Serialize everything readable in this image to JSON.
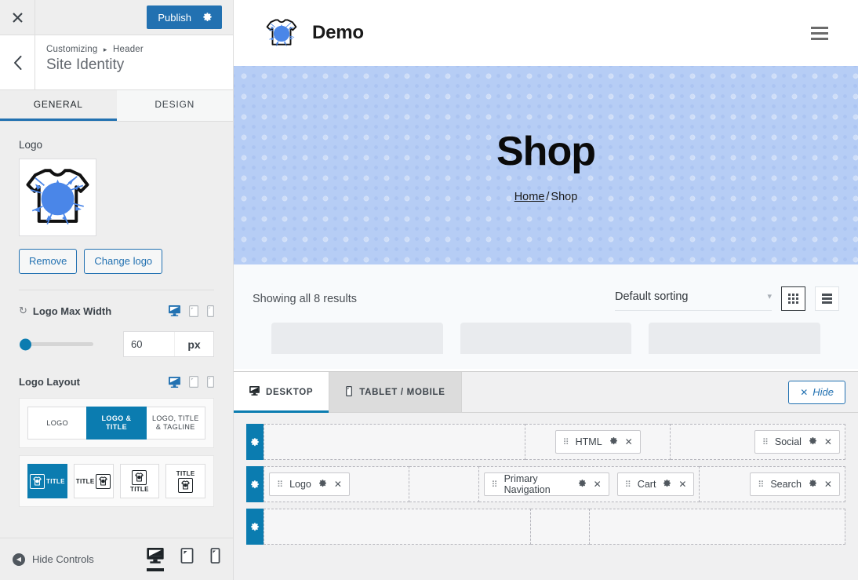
{
  "customizer": {
    "close_icon": "close-icon",
    "publish_label": "Publish",
    "publish_gear_icon": "gear-icon",
    "back_icon": "chevron-left-icon",
    "breadcrumb_root": "Customizing",
    "breadcrumb_sep": "▸",
    "breadcrumb_section": "Header",
    "panel_title": "Site Identity",
    "tabs": [
      {
        "label": "GENERAL",
        "active": true
      },
      {
        "label": "DESIGN",
        "active": false
      }
    ],
    "logo": {
      "label": "Logo",
      "image_alt": "tshirt-splatter-logo",
      "remove_label": "Remove",
      "change_label": "Change logo"
    },
    "logo_max_width": {
      "label": "Logo Max Width",
      "reset_icon": "reset-icon",
      "value": "60",
      "unit": "px",
      "devices": [
        {
          "name": "desktop-icon",
          "active": true
        },
        {
          "name": "tablet-icon",
          "active": false
        },
        {
          "name": "mobile-icon",
          "active": false
        }
      ]
    },
    "logo_layout": {
      "label": "Logo Layout",
      "devices": [
        {
          "name": "desktop-icon",
          "active": true
        },
        {
          "name": "tablet-icon",
          "active": false
        },
        {
          "name": "mobile-icon",
          "active": false
        }
      ],
      "options": [
        {
          "label": "LOGO",
          "active": false
        },
        {
          "label": "LOGO & TITLE",
          "active": true
        },
        {
          "label": "LOGO, TITLE & TAGLINE",
          "active": false
        }
      ],
      "positions": [
        {
          "name": "logo-left-title-right",
          "title": "TITLE",
          "active": true
        },
        {
          "name": "title-left-logo-right",
          "title": "TITLE",
          "active": false
        },
        {
          "name": "logo-top-title-bottom",
          "title": "TITLE",
          "active": false
        },
        {
          "name": "title-top-logo-bottom",
          "title": "TITLE",
          "active": false
        }
      ]
    },
    "footer": {
      "hide_controls_label": "Hide Controls",
      "devices": [
        {
          "name": "desktop-icon",
          "active": true
        },
        {
          "name": "tablet-icon",
          "active": false
        },
        {
          "name": "mobile-icon",
          "active": false
        }
      ]
    }
  },
  "preview": {
    "site_title": "Demo",
    "logo_alt": "tshirt-splatter-logo",
    "menu_icon": "hamburger-menu-icon",
    "hero": {
      "title": "Shop",
      "breadcrumb_home": "Home",
      "breadcrumb_sep": "/",
      "breadcrumb_current": "Shop"
    },
    "shop": {
      "results_text": "Showing all 8 results",
      "sorting_value": "Default sorting",
      "chevron_icon": "chevron-down-icon",
      "grid_view_icon": "grid-view-icon",
      "list_view_icon": "list-view-icon"
    }
  },
  "builder": {
    "tabs": [
      {
        "label": "DESKTOP",
        "icon": "desktop-icon",
        "active": true
      },
      {
        "label": "TABLET / MOBILE",
        "icon": "mobile-icon",
        "active": false
      }
    ],
    "hide_label": "Hide",
    "hide_icon": "close-icon",
    "rows": [
      {
        "name": "top-row",
        "gear_icon": "gear-icon",
        "zones": [
          {
            "align": "start",
            "flex": 45,
            "items": []
          },
          {
            "align": "center",
            "flex": 25,
            "items": [
              {
                "label": "HTML",
                "grip": "⠿",
                "gear": "gear-icon",
                "close": "close-icon"
              }
            ]
          },
          {
            "align": "end",
            "flex": 30,
            "items": [
              {
                "label": "Social",
                "grip": "⠿",
                "gear": "gear-icon",
                "close": "close-icon"
              }
            ]
          }
        ]
      },
      {
        "name": "main-row",
        "gear_icon": "gear-icon",
        "zones": [
          {
            "align": "start",
            "flex": 25,
            "items": [
              {
                "label": "Logo",
                "grip": "⠿",
                "gear": "gear-icon",
                "close": "close-icon"
              }
            ]
          },
          {
            "align": "center",
            "flex": 12,
            "items": []
          },
          {
            "align": "center",
            "flex": 38,
            "items": [
              {
                "label": "Primary Navigation",
                "grip": "⠿",
                "gear": "gear-icon",
                "close": "close-icon"
              },
              {
                "label": "Cart",
                "grip": "⠿",
                "gear": "gear-icon",
                "close": "close-icon"
              }
            ]
          },
          {
            "align": "end",
            "flex": 25,
            "items": [
              {
                "label": "Search",
                "grip": "⠿",
                "gear": "gear-icon",
                "close": "close-icon"
              }
            ]
          }
        ]
      },
      {
        "name": "bottom-row",
        "gear_icon": "gear-icon",
        "zones": [
          {
            "align": "start",
            "flex": 62,
            "items": []
          },
          {
            "align": "center",
            "flex": 13,
            "items": []
          },
          {
            "align": "end",
            "flex": 25,
            "items": []
          }
        ]
      }
    ]
  },
  "colors": {
    "accent": "#0b7cb0",
    "publish": "#2271b1",
    "hero_bg": "#b6cdf5",
    "logo_splatter": "#4a86e8"
  }
}
